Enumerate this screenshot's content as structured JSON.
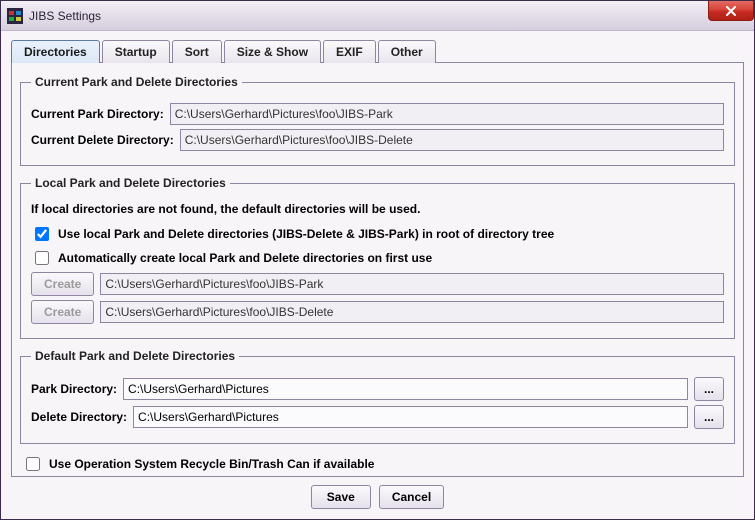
{
  "window": {
    "title": "JIBS Settings"
  },
  "tabs": {
    "items": [
      {
        "label": "Directories",
        "selected": true
      },
      {
        "label": "Startup",
        "selected": false
      },
      {
        "label": "Sort",
        "selected": false
      },
      {
        "label": "Size & Show",
        "selected": false
      },
      {
        "label": "EXIF",
        "selected": false
      },
      {
        "label": "Other",
        "selected": false
      }
    ]
  },
  "current": {
    "legend": "Current Park and Delete Directories",
    "park_label": "Current Park Directory:",
    "park_value": "C:\\Users\\Gerhard\\Pictures\\foo\\JIBS-Park",
    "delete_label": "Current Delete Directory:",
    "delete_value": "C:\\Users\\Gerhard\\Pictures\\foo\\JIBS-Delete"
  },
  "local": {
    "legend": "Local Park and Delete Directories",
    "notice": "If local directories are not found, the default directories will be used.",
    "use_local_label": "Use local Park and Delete directories (JIBS-Delete & JIBS-Park) in root of directory tree",
    "use_local_checked": true,
    "auto_create_label": "Automatically create local Park and Delete directories on first use",
    "auto_create_checked": false,
    "create_btn": "Create",
    "park_value": "C:\\Users\\Gerhard\\Pictures\\foo\\JIBS-Park",
    "delete_value": "C:\\Users\\Gerhard\\Pictures\\foo\\JIBS-Delete"
  },
  "defaults": {
    "legend": "Default Park and Delete Directories",
    "park_label": "Park Directory:",
    "park_value": "C:\\Users\\Gerhard\\Pictures",
    "delete_label": "Delete Directory:",
    "delete_value": "C:\\Users\\Gerhard\\Pictures",
    "browse_label": "..."
  },
  "recycle": {
    "label": "Use Operation System Recycle Bin/Trash Can if available",
    "checked": false
  },
  "footer": {
    "save": "Save",
    "cancel": "Cancel"
  }
}
